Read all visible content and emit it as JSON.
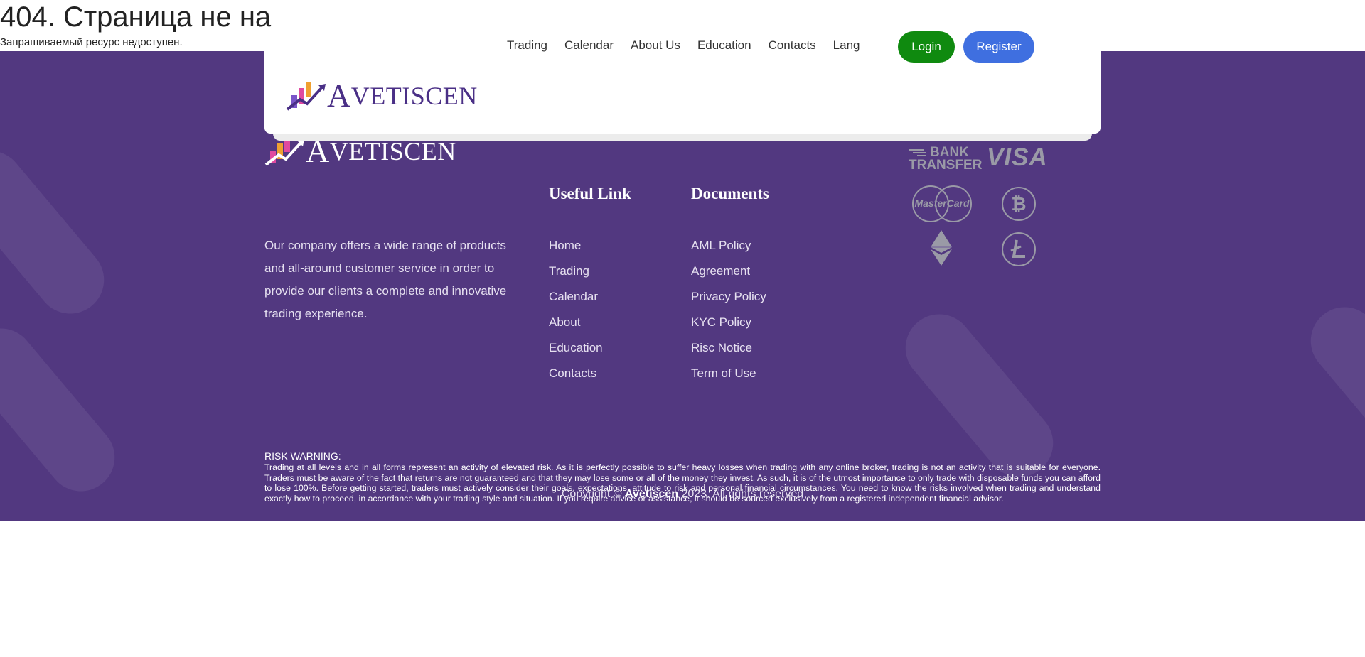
{
  "error": {
    "title": "404. Страница не на",
    "subtitle": "Запрашиваемый ресурс недоступен."
  },
  "brand": {
    "first_letter": "A",
    "rest": "VETISCEN",
    "accent_colors": [
      "#f0a030",
      "#e04aa0",
      "#7a55c8"
    ]
  },
  "header": {
    "nav": [
      "Trading",
      "Calendar",
      "About Us",
      "Education",
      "Contacts",
      "Lang"
    ],
    "login_label": "Login",
    "register_label": "Register"
  },
  "footer": {
    "about": "Our company offers a wide range of products and all-around customer service in order to provide our clients a complete and innovative trading experience.",
    "useful_links": {
      "title": "Useful Link",
      "items": [
        "Home",
        "Trading",
        "Calendar",
        "About",
        "Education",
        "Contacts"
      ]
    },
    "documents": {
      "title": "Documents",
      "items": [
        "AML Policy",
        "Agreement",
        "Privacy Policy",
        "KYC Policy",
        "Risc Notice",
        "Term of Use"
      ]
    },
    "payments": {
      "bank_line1": "BANK",
      "bank_line2": "TRANSFER",
      "visa": "VISA",
      "mastercard": "MasterCard",
      "icons": [
        "bank-transfer-icon",
        "visa-icon",
        "mastercard-icon",
        "bitcoin-icon",
        "ethereum-icon",
        "litecoin-icon"
      ]
    },
    "risk": {
      "title": "RISK WARNING:",
      "text": "Trading at all levels and in all forms represent an activity of elevated risk. As it is perfectly possible to suffer heavy losses when trading with any online broker, trading is not an activity that is suitable for everyone. Traders must be aware of the fact that returns are not guaranteed and that they may lose some or all of the money they invest. As such, it is of the utmost importance to only trade with disposable funds you can afford to lose 100%. Before getting started, traders must actively consider their goals, expectations, attitude to risk and personal financial circumstances. You need to know the risks involved when trading and understand exactly how to proceed, in accordance with your trading style and situation. If you require advice or assistance, it should be sourced exclusively from a registered independent financial advisor."
    },
    "copyright": {
      "prefix": "Copyright ©",
      "company": "Avetiscen",
      "suffix": "2023. All rights reserved"
    }
  },
  "colors": {
    "footer_bg": "#523880",
    "login_bg": "#0f8a0f",
    "register_bg": "#3f6fe0",
    "brand_purple": "#4a2f86"
  }
}
